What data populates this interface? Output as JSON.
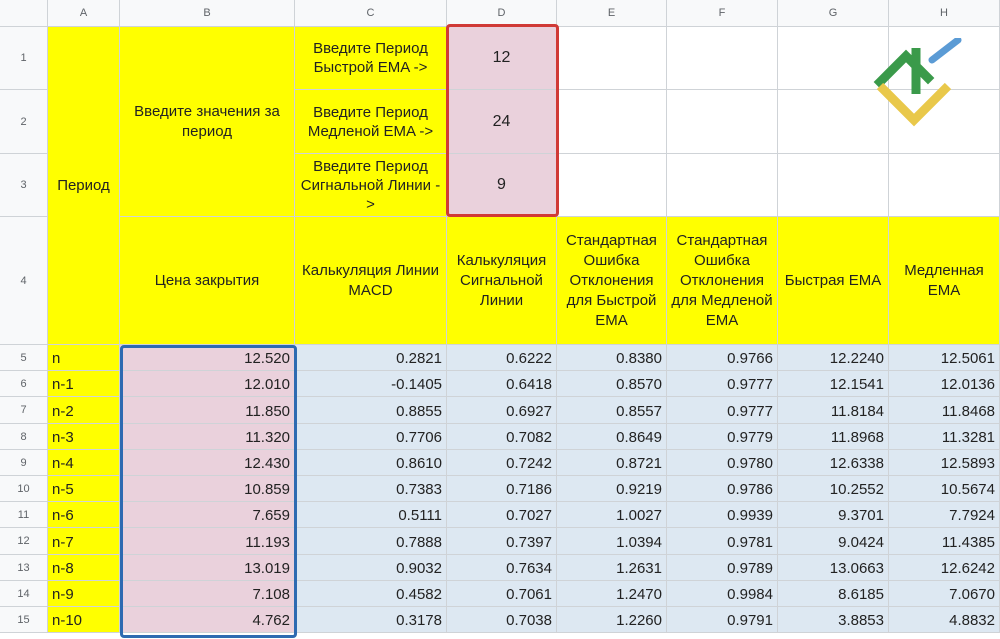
{
  "columns": [
    "A",
    "B",
    "C",
    "D",
    "E",
    "F",
    "G",
    "H"
  ],
  "rows": [
    "1",
    "2",
    "3",
    "4",
    "5",
    "6",
    "7",
    "8",
    "9",
    "10",
    "11",
    "12",
    "13",
    "14",
    "15"
  ],
  "header": {
    "period": "Период",
    "enter_values": "Введите значения за период",
    "fast_ema_prompt": "Введите Период Быстрой EMA ->",
    "slow_ema_prompt": "Введите Период Медленой EMA ->",
    "signal_prompt": "Введите Период Сигнальной Линии ->",
    "fast_ema_value": "12",
    "slow_ema_value": "24",
    "signal_value": "9"
  },
  "table_headers": {
    "close": "Цена закрытия",
    "macd": "Калькуляция Линии MACD",
    "signal": "Калькуляция Сигнальной Линии",
    "stderr_fast": "Стандартная Ошибка Отклонения для Быстрой EMA",
    "stderr_slow": "Стандартная Ошибка Отклонения для Медленой EMA",
    "fast_ema": "Быстрая EMA",
    "slow_ema": "Медленная EMA"
  },
  "data_rows": [
    {
      "label": "n",
      "close": "12.520",
      "macd": "0.2821",
      "signal": "0.6222",
      "se_fast": "0.8380",
      "se_slow": "0.9766",
      "fast": "12.2240",
      "slow": "12.5061"
    },
    {
      "label": "n-1",
      "close": "12.010",
      "macd": "-0.1405",
      "signal": "0.6418",
      "se_fast": "0.8570",
      "se_slow": "0.9777",
      "fast": "12.1541",
      "slow": "12.0136"
    },
    {
      "label": "n-2",
      "close": "11.850",
      "macd": "0.8855",
      "signal": "0.6927",
      "se_fast": "0.8557",
      "se_slow": "0.9777",
      "fast": "11.8184",
      "slow": "11.8468"
    },
    {
      "label": "n-3",
      "close": "11.320",
      "macd": "0.7706",
      "signal": "0.7082",
      "se_fast": "0.8649",
      "se_slow": "0.9779",
      "fast": "11.8968",
      "slow": "11.3281"
    },
    {
      "label": "n-4",
      "close": "12.430",
      "macd": "0.8610",
      "signal": "0.7242",
      "se_fast": "0.8721",
      "se_slow": "0.9780",
      "fast": "12.6338",
      "slow": "12.5893"
    },
    {
      "label": "n-5",
      "close": "10.859",
      "macd": "0.7383",
      "signal": "0.7186",
      "se_fast": "0.9219",
      "se_slow": "0.9786",
      "fast": "10.2552",
      "slow": "10.5674"
    },
    {
      "label": "n-6",
      "close": "7.659",
      "macd": "0.5111",
      "signal": "0.7027",
      "se_fast": "1.0027",
      "se_slow": "0.9939",
      "fast": "9.3701",
      "slow": "7.7924"
    },
    {
      "label": "n-7",
      "close": "11.193",
      "macd": "0.7888",
      "signal": "0.7397",
      "se_fast": "1.0394",
      "se_slow": "0.9781",
      "fast": "9.0424",
      "slow": "11.4385"
    },
    {
      "label": "n-8",
      "close": "13.019",
      "macd": "0.9032",
      "signal": "0.7634",
      "se_fast": "1.2631",
      "se_slow": "0.9789",
      "fast": "13.0663",
      "slow": "12.6242"
    },
    {
      "label": "n-9",
      "close": "7.108",
      "macd": "0.4582",
      "signal": "0.7061",
      "se_fast": "1.2470",
      "se_slow": "0.9984",
      "fast": "8.6185",
      "slow": "7.0670"
    },
    {
      "label": "n-10",
      "close": "4.762",
      "macd": "0.3178",
      "signal": "0.7038",
      "se_fast": "1.2260",
      "se_slow": "0.9791",
      "fast": "3.8853",
      "slow": "4.8832"
    }
  ],
  "colors": {
    "yellow": "#ffff00",
    "pink": "#ead1dc",
    "blue": "#dde8f2",
    "red_border": "#d03a36",
    "blue_border": "#2e6ab1"
  },
  "logo": {
    "icon": "brand-logo-icon",
    "colors": [
      "#3a9a4a",
      "#5b9bd5",
      "#e9c84a"
    ]
  }
}
